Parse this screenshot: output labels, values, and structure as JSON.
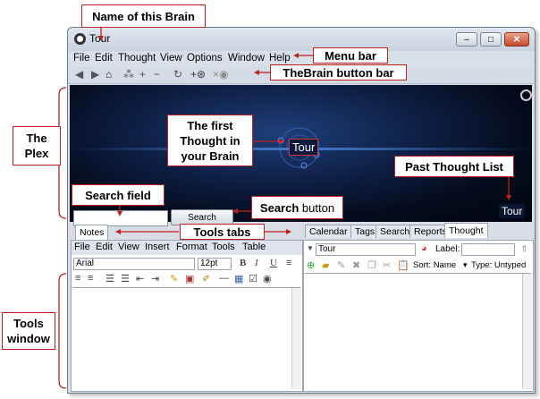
{
  "callouts": {
    "brain_name": "Name of this Brain",
    "menu_bar": "Menu bar",
    "button_bar": "TheBrain button bar",
    "plex_line1": "The",
    "plex_line2": "Plex",
    "first_thought_1": "The first",
    "first_thought_2": "Thought in",
    "first_thought_3": "your Brain",
    "past_list": "Past Thought List",
    "search_field": "Search field",
    "search_button_bold": "Search",
    "search_button_rest": " button",
    "tools_tabs": "Tools tabs",
    "tools_window_1": "Tools",
    "tools_window_2": "window"
  },
  "window": {
    "title": "Tour",
    "minimize": "–",
    "maximize": "□",
    "close": "✕"
  },
  "menu": [
    "File",
    "Edit",
    "Thought",
    "View",
    "Options",
    "Window",
    "Help"
  ],
  "plex": {
    "central_thought": "Tour",
    "past_thought": "Tour",
    "search_button": "Search"
  },
  "notes": {
    "tab": "Notes",
    "menu": [
      "File",
      "Edit",
      "View",
      "Insert",
      "Format",
      "Tools",
      "Table"
    ],
    "font": "Arial",
    "size": "12pt",
    "bold": "B",
    "italic": "I",
    "underline": "U"
  },
  "thought_panel": {
    "tabs": [
      "Calendar",
      "Tags",
      "Search",
      "Reports",
      "Thought"
    ],
    "name": "Tour",
    "label_caption": "Label:",
    "sort": "Sort: Name",
    "type": "Type: Untyped"
  },
  "colors": {
    "accent_red": "#b22222",
    "plex_dark": "#050b1c",
    "plex_blue": "#1f3f7a"
  }
}
